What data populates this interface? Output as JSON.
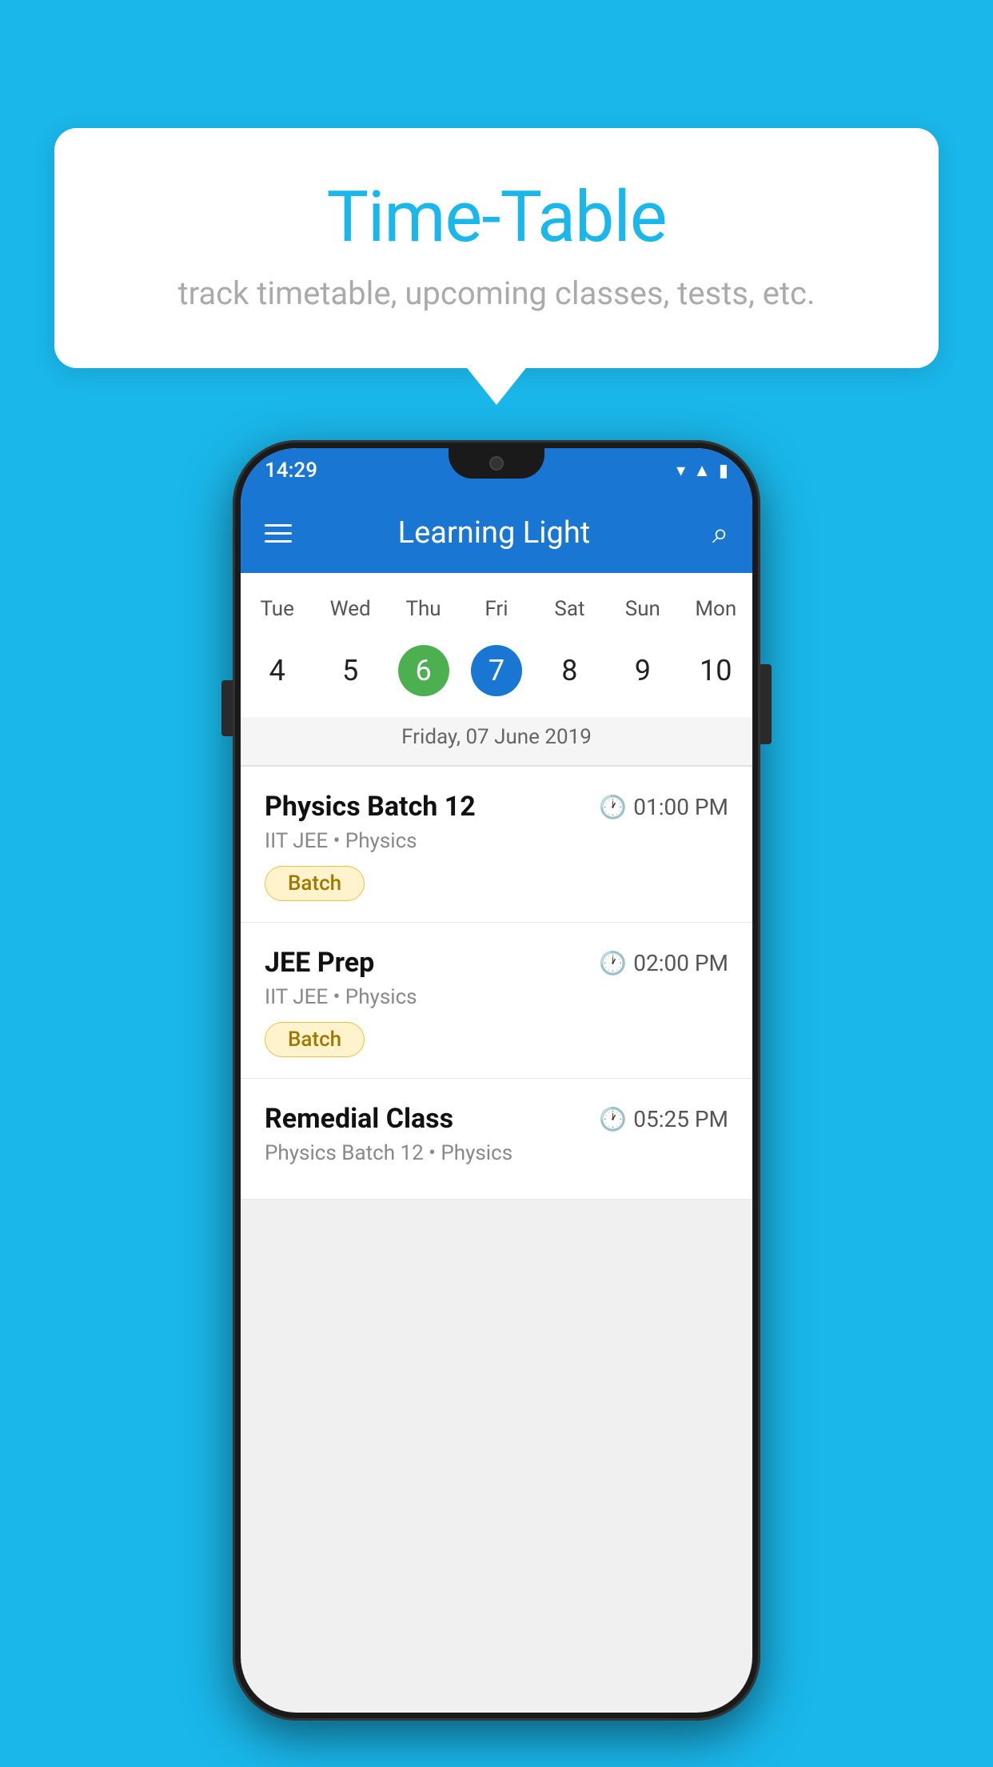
{
  "background": {
    "color": "#1ab7ea"
  },
  "tooltip": {
    "title": "Time-Table",
    "subtitle": "track timetable, upcoming classes, tests, etc."
  },
  "phone": {
    "statusBar": {
      "time": "14:29"
    },
    "appBar": {
      "title": "Learning Light"
    },
    "calendar": {
      "dayNames": [
        "Tue",
        "Wed",
        "Thu",
        "Fri",
        "Sat",
        "Sun",
        "Mon"
      ],
      "dayNumbers": [
        "4",
        "5",
        "6",
        "7",
        "8",
        "9",
        "10"
      ],
      "selectedDate": "Friday, 07 June 2019",
      "todayIndex": 2,
      "selectedIndex": 3
    },
    "schedule": [
      {
        "title": "Physics Batch 12",
        "time": "01:00 PM",
        "subtitle": "IIT JEE • Physics",
        "tag": "Batch"
      },
      {
        "title": "JEE Prep",
        "time": "02:00 PM",
        "subtitle": "IIT JEE • Physics",
        "tag": "Batch"
      },
      {
        "title": "Remedial Class",
        "time": "05:25 PM",
        "subtitle": "Physics Batch 12 • Physics",
        "tag": ""
      }
    ]
  }
}
